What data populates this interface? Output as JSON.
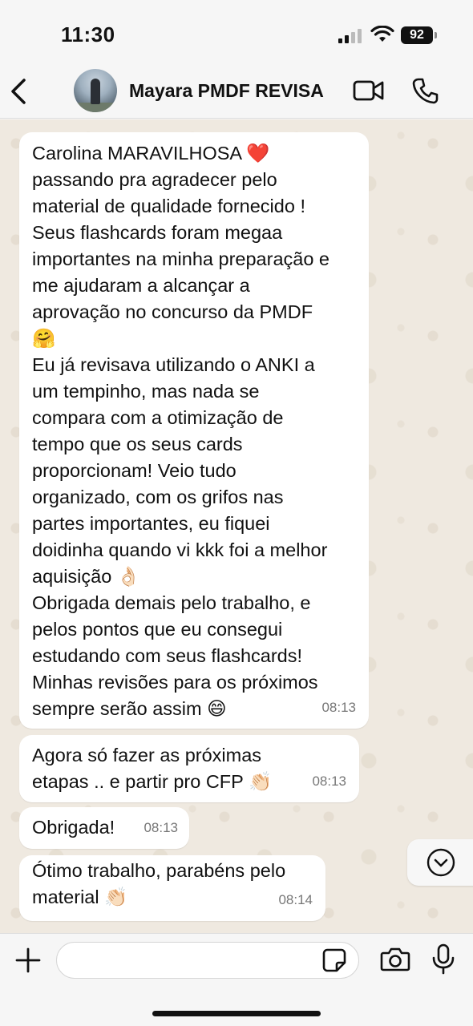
{
  "status_bar": {
    "time": "11:30",
    "battery": "92"
  },
  "header": {
    "contact_name": "Mayara PMDF REVISA",
    "icons": [
      "back-chevron-icon",
      "video-call-icon",
      "phone-call-icon"
    ]
  },
  "messages": [
    {
      "text": "Carolina MARAVILHOSA ❤️\npassando pra agradecer pelo\nmaterial de qualidade fornecido !\nSeus flashcards foram megaa\nimportantes na minha preparação e\nme ajudaram a alcançar a\naprovação no concurso da PMDF\n🤗\nEu já revisava utilizando o ANKI a\num tempinho, mas nada se\ncompara com a otimização de\ntempo que os seus cards\nproporcionam! Veio tudo\norganizado, com os grifos nas\npartes importantes, eu fiquei\ndoidinha quando vi kkk foi a melhor\naquisição 👌🏻\nObrigada demais pelo trabalho, e\npelos pontos que eu consegui\nestudando com seus flashcards!\nMinhas revisões para os próximos\nsempre serão assim 😄",
      "time": "08:13"
    },
    {
      "text": "Agora só fazer as próximas\netapas .. e partir pro CFP 👏🏻",
      "time": "08:13"
    },
    {
      "text": "Obrigada!",
      "time": "08:13"
    },
    {
      "text": "Ótimo trabalho, parabéns pelo\nmaterial 👏🏻",
      "time": "08:14"
    }
  ],
  "composer": {
    "placeholder": "",
    "icons": [
      "plus-icon",
      "sticker-icon",
      "camera-icon",
      "microphone-icon"
    ]
  },
  "colors": {
    "chat_background": "#efe9e0",
    "bubble_background": "#ffffff",
    "bar_background": "#f6f6f6"
  }
}
